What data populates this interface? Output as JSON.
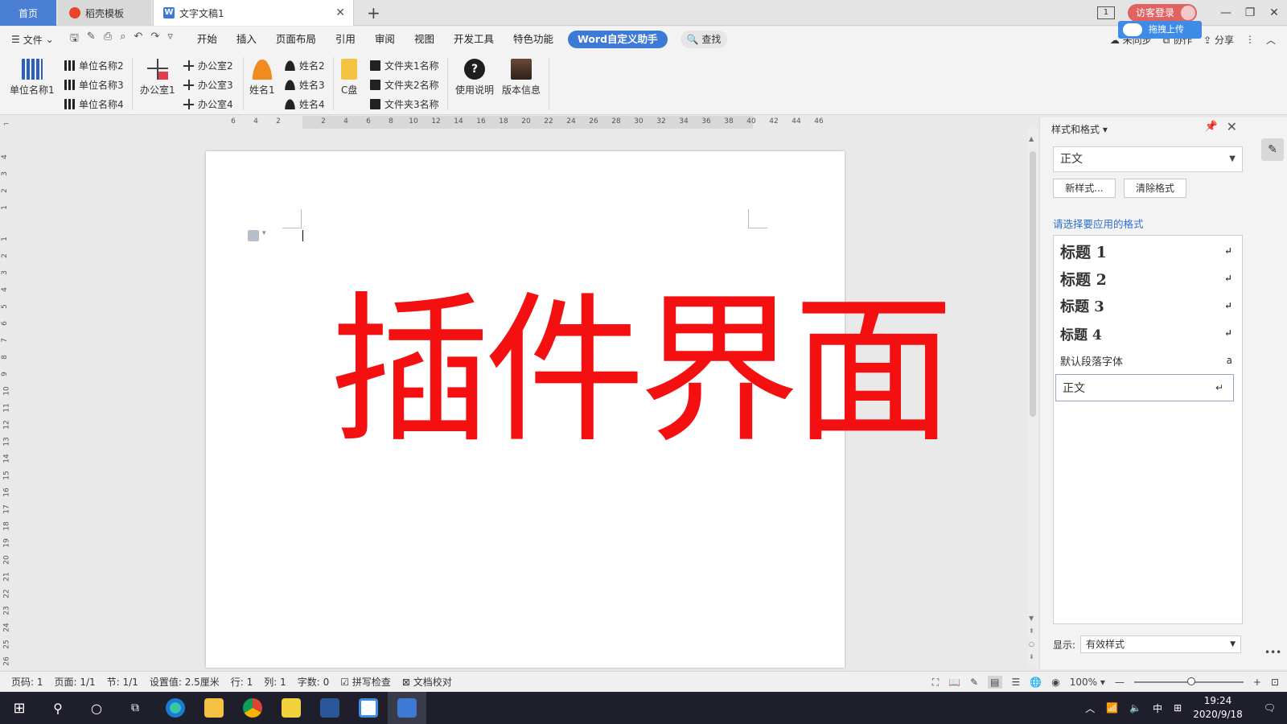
{
  "tabs": {
    "home": "首页",
    "template": "稻壳模板",
    "document": "文字文稿1",
    "new_tab": "+"
  },
  "titlebar": {
    "page_count_icon": "1",
    "login": "访客登录",
    "minimize": "—",
    "restore": "❐",
    "close": "✕"
  },
  "menubar": {
    "file": "文件",
    "items": [
      "开始",
      "插入",
      "页面布局",
      "引用",
      "审阅",
      "视图",
      "开发工具",
      "特色功能"
    ],
    "active_item": "Word自定义助手",
    "search": "查找",
    "right": {
      "sync": "未同步",
      "collab": "协作",
      "share": "分享"
    },
    "upload_badge": "拖拽上传"
  },
  "ribbon": {
    "unit1": "单位名称1",
    "unit2": "单位名称2",
    "unit3": "单位名称3",
    "unit4": "单位名称4",
    "office1": "办公室1",
    "office2": "办公室2",
    "office3": "办公室3",
    "office4": "办公室4",
    "name1": "姓名1",
    "name2": "姓名2",
    "name3": "姓名3",
    "name4": "姓名4",
    "cdrive": "C盘",
    "folder1": "文件夹1名称",
    "folder2": "文件夹2名称",
    "folder3": "文件夹3名称",
    "help": "使用说明",
    "version": "版本信息"
  },
  "ruler": {
    "h_ticks": [
      "6",
      "4",
      "2",
      "2",
      "4",
      "6",
      "8",
      "10",
      "12",
      "14",
      "16",
      "18",
      "20",
      "22",
      "24",
      "26",
      "28",
      "30",
      "32",
      "34",
      "36",
      "38",
      "40",
      "42",
      "44",
      "46"
    ],
    "v_ticks": [
      "4",
      "3",
      "2",
      "1",
      "1",
      "2",
      "3",
      "4",
      "5",
      "6",
      "7",
      "8",
      "9",
      "10",
      "11",
      "12",
      "13",
      "14",
      "15",
      "16",
      "17",
      "18",
      "19",
      "20",
      "21",
      "22",
      "23",
      "24",
      "25",
      "26"
    ]
  },
  "document": {
    "overlay_text": "插件界面"
  },
  "style_pane": {
    "title": "样式和格式",
    "current_style": "正文",
    "new_style": "新样式...",
    "clear_format": "清除格式",
    "apply_label": "请选择要应用的格式",
    "styles": [
      {
        "label": "标题  1",
        "mark": "↵"
      },
      {
        "label": "标题  2",
        "mark": "↵"
      },
      {
        "label": "标题  3",
        "mark": "↵"
      },
      {
        "label": "标题  4",
        "mark": "↵"
      },
      {
        "label": "默认段落字体",
        "mark": "a"
      },
      {
        "label": "正文",
        "mark": "↵"
      }
    ],
    "show_label": "显示:",
    "show_value": "有效样式"
  },
  "statusbar": {
    "page_num": "页码: 1",
    "pages": "页面: 1/1",
    "section": "节: 1/1",
    "setting": "设置值: 2.5厘米",
    "row": "行: 1",
    "col": "列: 1",
    "words": "字数: 0",
    "spell": "拼写检查",
    "proof": "文档校对",
    "zoom": "100%"
  },
  "taskbar": {
    "time": "19:24",
    "date": "2020/9/18",
    "ime": "中"
  },
  "colors": {
    "accent": "#3d7ad6",
    "overlay_red": "#f41010",
    "login_red": "#e06262",
    "link_blue": "#2f6fd1"
  }
}
